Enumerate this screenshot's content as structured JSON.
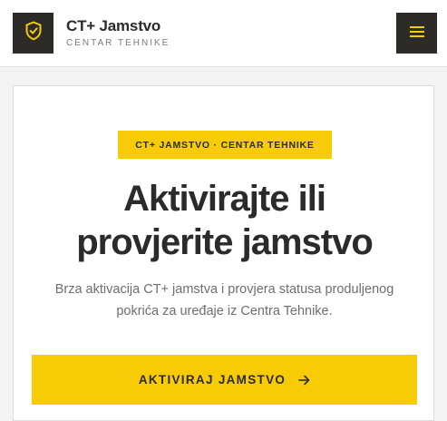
{
  "header": {
    "brand_name": "CT+ Jamstvo",
    "brand_sub": "CENTAR TEHNIKE",
    "logo_icon": "shield-check-icon",
    "menu_icon": "hamburger-menu-icon"
  },
  "hero": {
    "badge": "CT+ JAMSTVO · CENTAR TEHNIKE",
    "title_line1": "Aktivirajte ili",
    "title_line2": "provjerite jamstvo",
    "subtitle_line1": "Brza aktivacija CT+ jamstva i provjera statusa produljenog",
    "subtitle_line2": "pokrića za uređaje iz Centra Tehnike.",
    "cta_label": "AKTIVIRAJ JAMSTVO",
    "cta_icon": "arrow-right-icon"
  },
  "colors": {
    "accent": "#f7cc06",
    "dark": "#2c2b27",
    "text": "#2b2b2b",
    "muted": "#6e6e6e"
  }
}
